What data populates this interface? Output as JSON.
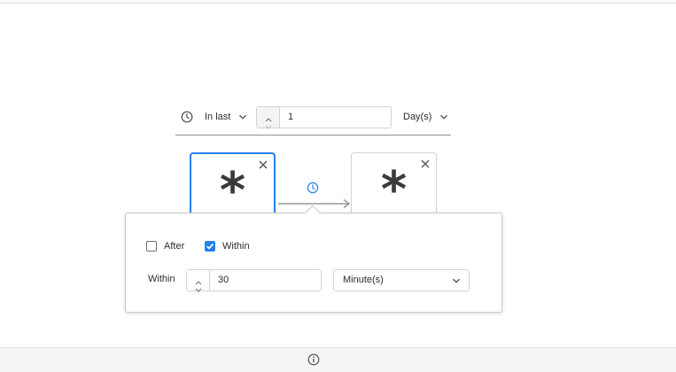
{
  "time_scope": {
    "mode_label": "In last",
    "value": "1",
    "unit_label": "Day(s)"
  },
  "events": [
    {
      "symbol": "*"
    },
    {
      "symbol": "*"
    }
  ],
  "popover": {
    "after_label": "After",
    "after_checked": false,
    "within_label": "Within",
    "within_checked": true,
    "within_row_label": "Within",
    "within_value": "30",
    "unit_value": "Minute(s)"
  },
  "colors": {
    "accent": "#2680eb",
    "border": "#d3d3d3",
    "text": "#2c2c2c"
  },
  "icons": [
    "clock-icon",
    "chevron-down-icon",
    "chevron-up-icon",
    "close-icon",
    "info-icon"
  ]
}
